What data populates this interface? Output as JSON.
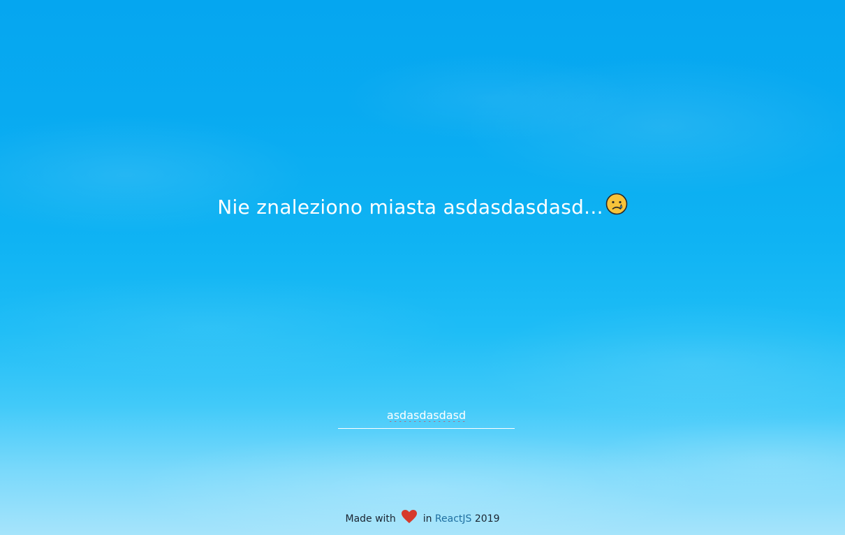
{
  "message": {
    "text": "Nie znaleziono miasta asdasdasdasd...",
    "emoji_icon": "sad-tear-face-icon"
  },
  "search": {
    "value": "asdasdasdasd"
  },
  "footer": {
    "made_with": "Made with",
    "heart_icon": "heart-icon",
    "in": "in",
    "link_text": "ReactJS",
    "year": "2019"
  },
  "colors": {
    "text": "#ffffff",
    "heart": "#d63a2c",
    "link": "#1f6fa0",
    "footer_text": "#1a2430"
  }
}
